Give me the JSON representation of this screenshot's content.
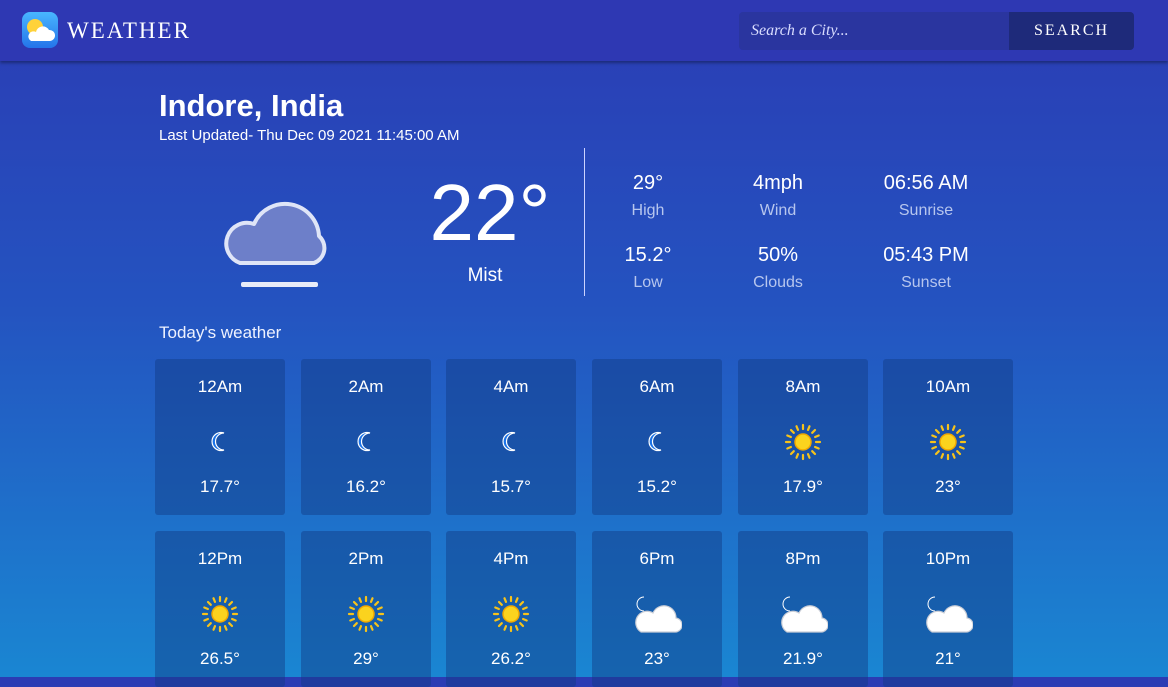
{
  "header": {
    "app_title": "WEATHER",
    "search_placeholder": "Search a City...",
    "search_button": "SEARCH"
  },
  "location": {
    "city": "Indore, India",
    "last_updated": "Last Updated- Thu Dec 09 2021 11:45:00 AM"
  },
  "current": {
    "temperature": "22°",
    "condition": "Mist",
    "icon": "mist-cloud-icon",
    "stats": [
      {
        "value": "29°",
        "label": "High"
      },
      {
        "value": "4mph",
        "label": "Wind"
      },
      {
        "value": "06:56 AM",
        "label": "Sunrise"
      },
      {
        "value": "15.2°",
        "label": "Low"
      },
      {
        "value": "50%",
        "label": "Clouds"
      },
      {
        "value": "05:43 PM",
        "label": "Sunset"
      }
    ]
  },
  "hourly": {
    "title": "Today's weather",
    "items": [
      {
        "time": "12Am",
        "temp": "17.7°",
        "icon": "moon-icon"
      },
      {
        "time": "2Am",
        "temp": "16.2°",
        "icon": "moon-icon"
      },
      {
        "time": "4Am",
        "temp": "15.7°",
        "icon": "moon-icon"
      },
      {
        "time": "6Am",
        "temp": "15.2°",
        "icon": "moon-icon"
      },
      {
        "time": "8Am",
        "temp": "17.9°",
        "icon": "sun-icon"
      },
      {
        "time": "10Am",
        "temp": "23°",
        "icon": "sun-icon"
      },
      {
        "time": "12Pm",
        "temp": "26.5°",
        "icon": "sun-icon"
      },
      {
        "time": "2Pm",
        "temp": "29°",
        "icon": "sun-icon"
      },
      {
        "time": "4Pm",
        "temp": "26.2°",
        "icon": "sun-icon"
      },
      {
        "time": "6Pm",
        "temp": "23°",
        "icon": "moon-cloud-icon"
      },
      {
        "time": "8Pm",
        "temp": "21.9°",
        "icon": "moon-cloud-icon"
      },
      {
        "time": "10Pm",
        "temp": "21°",
        "icon": "moon-cloud-icon"
      }
    ]
  },
  "colors": {
    "header_bg": "#2e38b3",
    "gradient_top": "#2b3cb4",
    "gradient_bottom": "#1a86d2",
    "sun": "#f7c31a",
    "moon": "#1b73e8"
  }
}
